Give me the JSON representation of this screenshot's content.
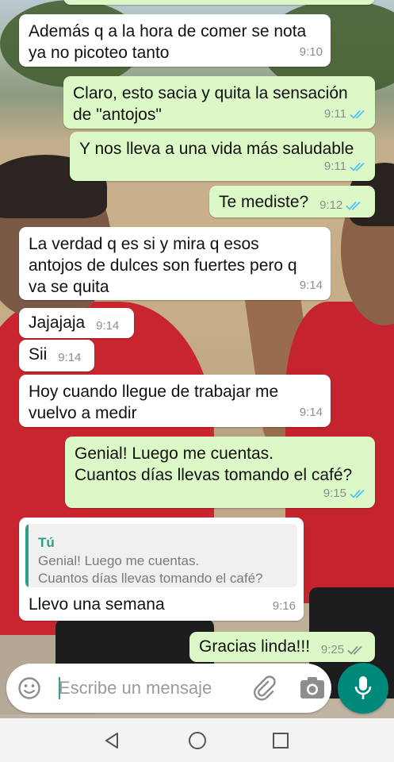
{
  "messages": [
    {
      "id": "m1",
      "direction": "in",
      "text": "Además q a la hora de comer se nota\nya no picoteo tanto",
      "time": "9:10"
    },
    {
      "id": "m2",
      "direction": "out",
      "text": "Claro, esto sacia y quita la sensación\nde \"antojos\"",
      "time": "9:11",
      "status": "read"
    },
    {
      "id": "m3",
      "direction": "out",
      "text": "Y nos lleva a una vida más saludable",
      "time": "9:11",
      "status": "read"
    },
    {
      "id": "m4",
      "direction": "out",
      "text": "Te mediste?",
      "time": "9:12",
      "status": "read"
    },
    {
      "id": "m5",
      "direction": "in",
      "text": "La verdad q es si y mira q esos\nantojos de dulces son fuertes pero q\nva se quita",
      "time": "9:14"
    },
    {
      "id": "m6",
      "direction": "in",
      "text": "Jajajaja",
      "time": "9:14"
    },
    {
      "id": "m7",
      "direction": "in",
      "text": "Sii",
      "time": "9:14"
    },
    {
      "id": "m8",
      "direction": "in",
      "text": "Hoy cuando llegue de trabajar me\nvuelvo a medir",
      "time": "9:14"
    },
    {
      "id": "m9",
      "direction": "out",
      "text": "Genial! Luego me cuentas.\nCuantos días llevas tomando el café?",
      "time": "9:15",
      "status": "read"
    },
    {
      "id": "m10",
      "direction": "in",
      "text": "Llevo una semana",
      "time": "9:16",
      "quote": {
        "author": "Tú",
        "text": "Genial! Luego me cuentas.\nCuantos días llevas tomando el café?"
      }
    },
    {
      "id": "m11",
      "direction": "out",
      "text": "Gracias linda!!!",
      "time": "9:25",
      "status": "delivered"
    }
  ],
  "input": {
    "placeholder": "Escribe un mensaje"
  },
  "icons": {
    "emoji": "emoji-icon",
    "attach": "paperclip-icon",
    "camera": "camera-icon",
    "mic": "microphone-icon",
    "back": "back-triangle-icon",
    "home": "home-circle-icon",
    "recents": "recents-square-icon"
  },
  "colors": {
    "incoming_bubble": "#ffffff",
    "outgoing_bubble": "#dcf8c6",
    "read_ticks": "#4fc3f7",
    "delivered_ticks": "#8a8f8a",
    "accent": "#00897b",
    "quote_author": "#2f9e86"
  }
}
